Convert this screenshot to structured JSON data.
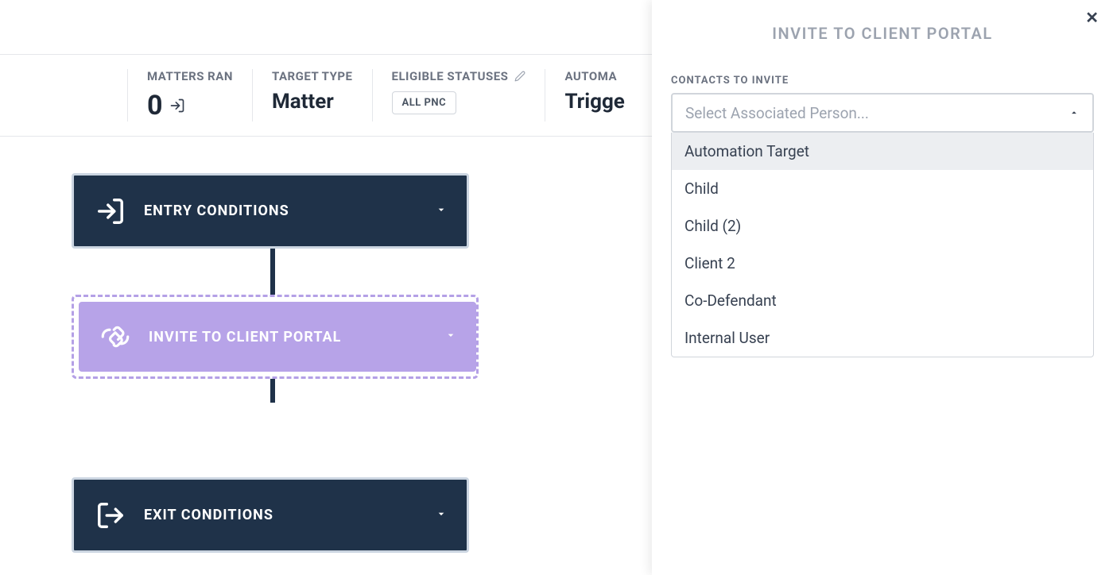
{
  "stats": {
    "matters_ran": {
      "label": "MATTERS RAN",
      "value": "0"
    },
    "target_type": {
      "label": "TARGET TYPE",
      "value": "Matter"
    },
    "eligible_statuses": {
      "label": "ELIGIBLE STATUSES",
      "chip": "ALL PNC"
    },
    "automa": {
      "label": "AUTOMA",
      "value": "Trigge"
    }
  },
  "flow": {
    "entry": "ENTRY CONDITIONS",
    "invite": "INVITE TO CLIENT PORTAL",
    "exit": "EXIT CONDITIONS"
  },
  "panel": {
    "title": "INVITE TO CLIENT PORTAL",
    "field_label": "CONTACTS TO INVITE",
    "placeholder": "Select Associated Person...",
    "options": [
      "Automation Target",
      "Child",
      "Child (2)",
      "Client 2",
      "Co-Defendant",
      "Internal User"
    ]
  }
}
